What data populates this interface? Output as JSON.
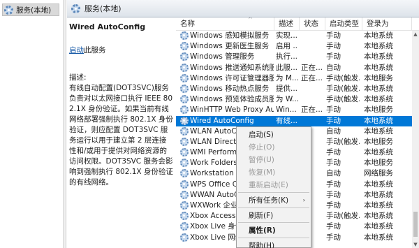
{
  "tree": {
    "root_label": "服务(本地)"
  },
  "header": {
    "title": "服务(本地)"
  },
  "description": {
    "service_title": "Wired AutoConfig",
    "start_link": "启动",
    "start_suffix": "此服务",
    "desc_label": "描述:",
    "desc_text": "有线自动配置(DOT3SVC)服务负责对以太网接口执行 IEEE 802.1X 身份验证。如果当前有线网络部署强制执行 802.1X 身份验证，则应配置 DOT3SVC 服务运行以用于建立第 2 层连接性和/或用于提供对网络资源的访问权限。DOT3SVC 服务会影响到强制执行 802.1X 身份验证的有线网络。"
  },
  "columns": {
    "name": "名称",
    "desc": "描述",
    "status": "状态",
    "start": "启动类型",
    "logon": "登录为"
  },
  "rows": [
    {
      "name": "Windows 感知模拟服务",
      "desc": "实现...",
      "status": "",
      "start": "手动",
      "logon": "本地系统"
    },
    {
      "name": "Windows 更新医生服务",
      "desc": "启用 ...",
      "status": "",
      "start": "手动",
      "logon": "本地系统"
    },
    {
      "name": "Windows 管理服务",
      "desc": "执行...",
      "status": "",
      "start": "手动",
      "logon": "本地系统"
    },
    {
      "name": "Windows 推送通知系统服务",
      "desc": "此服...",
      "status": "正在...",
      "start": "自动",
      "logon": "本地系统"
    },
    {
      "name": "Windows 许可证管理器服务",
      "desc": "为 M...",
      "status": "正在...",
      "start": "手动(触发...",
      "logon": "本地服务"
    },
    {
      "name": "Windows 移动热点服务",
      "desc": "提供...",
      "status": "",
      "start": "手动(触发...",
      "logon": "本地系统"
    },
    {
      "name": "Windows 预览体验成员服务",
      "desc": "为 W...",
      "status": "",
      "start": "手动(触发...",
      "logon": "本地系统"
    },
    {
      "name": "WinHTTP Web Proxy Aut...",
      "desc": "Win...",
      "status": "正在...",
      "start": "手动",
      "logon": "本地服务"
    },
    {
      "name": "Wired AutoConfig",
      "desc": "有线...",
      "status": "",
      "start": "手动",
      "logon": "本地系统"
    },
    {
      "name": "WLAN AutoCo...",
      "desc": "",
      "status": "",
      "start": "自动",
      "logon": "本地系统"
    },
    {
      "name": "WLAN Direct ...",
      "desc": "",
      "status": "",
      "start": "手动(触发...",
      "logon": "本地服务"
    },
    {
      "name": "WMI Perform...",
      "desc": "",
      "status": "",
      "start": "手动",
      "logon": "本地系统"
    },
    {
      "name": "Work Folders",
      "desc": "",
      "status": "",
      "start": "手动",
      "logon": "本地服务"
    },
    {
      "name": "Workstation",
      "desc": "",
      "status": "",
      "start": "自动",
      "logon": "网络服务"
    },
    {
      "name": "WPS Office Cl...",
      "desc": "",
      "status": "",
      "start": "手动",
      "logon": "本地系统"
    },
    {
      "name": "WWAN AutoC...",
      "desc": "",
      "status": "",
      "start": "手动",
      "logon": "本地系统"
    },
    {
      "name": "WXWork 企业...",
      "desc": "",
      "status": "",
      "start": "手动",
      "logon": "本地系统"
    },
    {
      "name": "Xbox Accessor...",
      "desc": "",
      "status": "",
      "start": "手动(触发...",
      "logon": "本地系统"
    },
    {
      "name": "Xbox Live 身份...",
      "desc": "",
      "status": "",
      "start": "手动",
      "logon": "本地系统"
    },
    {
      "name": "Xbox Live 网络...",
      "desc": "",
      "status": "",
      "start": "手动",
      "logon": "本地系统"
    }
  ],
  "selected_row": 8,
  "context_menu": {
    "items": [
      {
        "label": "启动(S)",
        "disabled": false
      },
      {
        "label": "停止(O)",
        "disabled": true
      },
      {
        "label": "暂停(U)",
        "disabled": true
      },
      {
        "label": "恢复(M)",
        "disabled": true
      },
      {
        "label": "重新启动(E)",
        "disabled": true
      },
      {
        "label": "所有任务(K)",
        "disabled": false,
        "submenu": true
      },
      {
        "label": "刷新(F)",
        "disabled": false
      },
      {
        "label": "属性(R)",
        "disabled": false,
        "bold": true
      },
      {
        "label": "帮助(H)",
        "disabled": false
      }
    ]
  },
  "colors": {
    "selection": "#0078d7",
    "link": "#1558a6"
  },
  "icons": {
    "service": "gear-icon",
    "submenu": "chevron-right-icon"
  }
}
